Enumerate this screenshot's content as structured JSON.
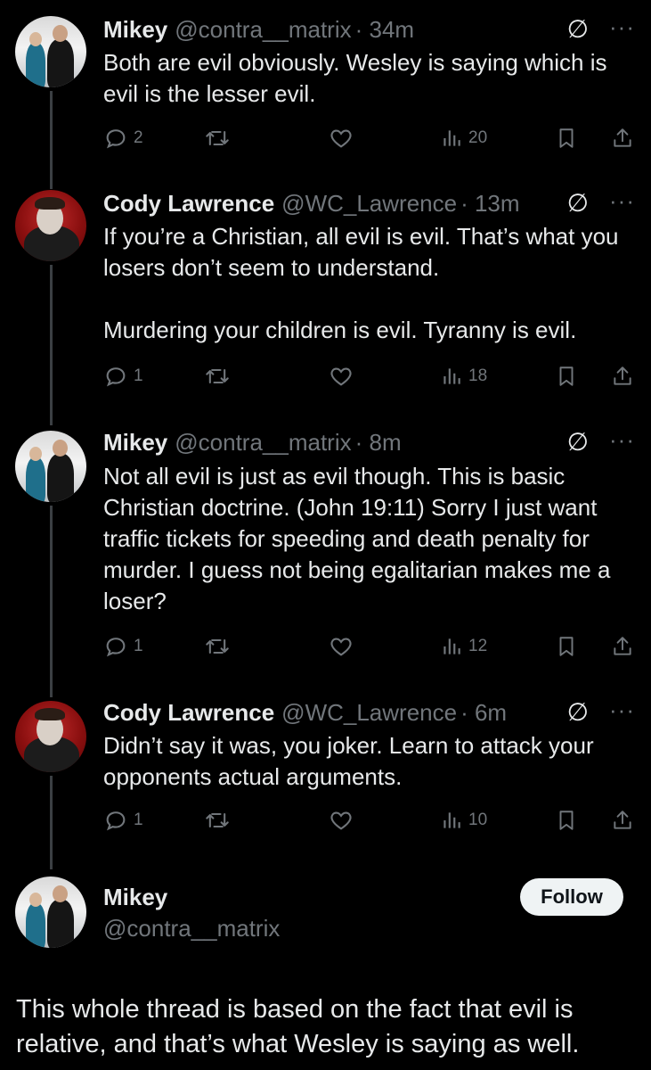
{
  "tweets": [
    {
      "name": "Mikey",
      "handle": "@contra__matrix",
      "time": "· 34m",
      "text": "Both are evil obviously. Wesley is saying which is evil is the lesser evil.",
      "replies": "2",
      "retweets": "",
      "likes": "",
      "views": "20",
      "avatar": "mikey"
    },
    {
      "name": "Cody Lawrence",
      "handle": "@WC_Lawrence",
      "time": "· 13m",
      "text": "If you’re a Christian, all evil is evil. That’s what you losers don’t seem to understand.\n\nMurdering your children is evil. Tyranny is evil.",
      "replies": "1",
      "retweets": "",
      "likes": "",
      "views": "18",
      "avatar": "cody"
    },
    {
      "name": "Mikey",
      "handle": "@contra__matrix",
      "time": "· 8m",
      "text": "Not all evil is just as evil though. This is basic Christian doctrine. (John 19:11) Sorry I just want traffic tickets for speeding and death penalty for murder. I guess not being egalitarian makes me a loser?",
      "replies": "1",
      "retweets": "",
      "likes": "",
      "views": "12",
      "avatar": "mikey"
    },
    {
      "name": "Cody Lawrence",
      "handle": "@WC_Lawrence",
      "time": "· 6m",
      "text": "Didn’t say it was, you joker. Learn to attack your opponents actual arguments.",
      "replies": "1",
      "retweets": "",
      "likes": "",
      "views": "10",
      "avatar": "cody"
    }
  ],
  "main": {
    "name": "Mikey",
    "handle": "@contra__matrix",
    "follow_label": "Follow",
    "text": "This whole thread is based on the fact that evil is relative, and that’s what Wesley is saying as well."
  },
  "icons": {
    "grok": "grok-icon",
    "more": "more-icon",
    "reply": "reply-icon",
    "retweet": "retweet-icon",
    "like": "like-icon",
    "views": "views-icon",
    "bookmark": "bookmark-icon",
    "share": "share-icon"
  },
  "colors": {
    "background": "#000000",
    "text": "#e7e9ea",
    "muted": "#71767b",
    "follow_bg": "#eff3f4"
  }
}
